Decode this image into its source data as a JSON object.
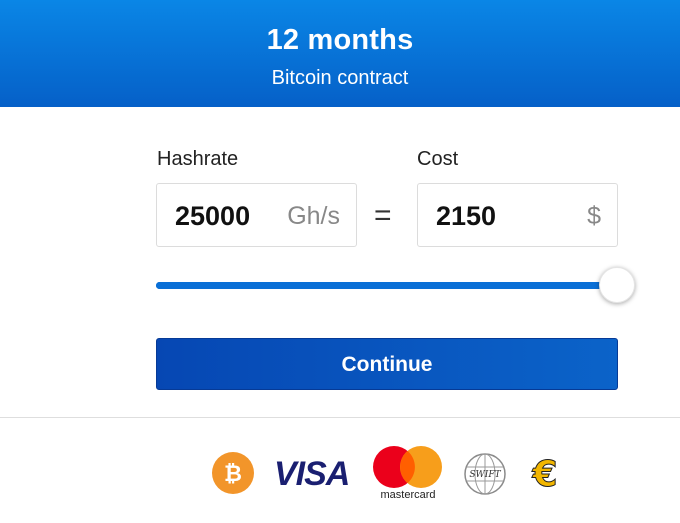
{
  "header": {
    "title": "12 months",
    "subtitle": "Bitcoin contract"
  },
  "hashrate": {
    "label": "Hashrate",
    "value": "25000",
    "unit": "Gh/s"
  },
  "equals": "=",
  "cost": {
    "label": "Cost",
    "value": "2150",
    "unit": "$"
  },
  "slider": {
    "level_percent": 100
  },
  "continue_label": "Continue",
  "payment_methods": {
    "visa": "VISA",
    "mastercard": "mastercard",
    "swift": "SWIFT"
  },
  "colors": {
    "header_blue": "#0a86e6",
    "button_blue": "#0647b3",
    "slider_blue": "#0a6fd6",
    "bitcoin_orange": "#f2952a"
  }
}
